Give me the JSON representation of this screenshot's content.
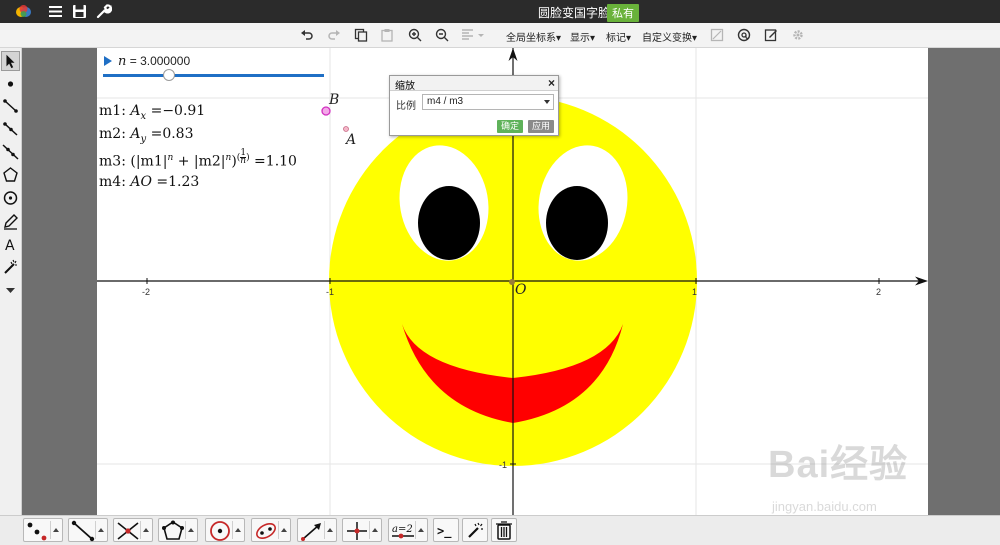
{
  "title_bar": {
    "document_title": "圆脸变国字脸",
    "badge": "私有",
    "icons": [
      "app-logo-icon",
      "menu-icon",
      "save-icon",
      "wrench-icon"
    ]
  },
  "toolbar": {
    "menus": [
      {
        "label": "全局坐标系▾"
      },
      {
        "label": "显示▾"
      },
      {
        "label": "标记▾"
      },
      {
        "label": "自定义变换▾"
      }
    ],
    "icons": [
      "undo-icon",
      "redo-icon",
      "copy-icon",
      "paste-icon",
      "zoom-in-icon",
      "zoom-out-icon",
      "align-icon",
      "snapshot-icon",
      "link-icon",
      "edit-icon",
      "settings-icon"
    ]
  },
  "left_tools": [
    "pointer-tool",
    "point-tool",
    "segment-tool",
    "ray-tool",
    "line-tool",
    "polygon-tool",
    "circle-tool",
    "pencil-tool",
    "text-tool",
    "magic-tool",
    "more-tools"
  ],
  "slider": {
    "variable": "n",
    "equals": " = ",
    "value": "3.000000",
    "position": 0.3
  },
  "measurements": [
    {
      "name": "m1",
      "expr": "A",
      "sub": "x",
      "value": "−0.91"
    },
    {
      "name": "m2",
      "expr": "A",
      "sub": "y",
      "value": "0.83"
    },
    {
      "name": "m3",
      "formula_a": "m1",
      "formula_b": "m2",
      "exp": "n",
      "frac_num": "1",
      "frac_den": "n",
      "value": "1.10"
    },
    {
      "name": "m4",
      "expr": "AO",
      "value": "1.23"
    }
  ],
  "points": {
    "A": "A",
    "B": "B",
    "O": "O"
  },
  "axis": {
    "x_ticks": [
      "-2",
      "-1",
      "1",
      "2"
    ],
    "y_ticks": [
      "-1"
    ]
  },
  "dialog": {
    "title": "缩放",
    "close": "×",
    "ratio_label": "比例",
    "ratio_value": "m4 / m3",
    "ok": "确定",
    "apply": "应用"
  },
  "colors": {
    "face": "#FFFF00",
    "eyes": "#000000",
    "mouth": "#FF0000",
    "slider": "#1F6FC5",
    "badge": "#69B23A"
  },
  "bottom_tools": [
    "point-group",
    "segment-group",
    "intersection-group",
    "polygon-group",
    "circle-group",
    "conic-group",
    "vector-group",
    "transform-group",
    "parameter-group",
    "script-tool",
    "magic-wand-tool",
    "delete-tool"
  ],
  "bottom_labels": {
    "parameter": "a=2",
    "script": ">_"
  },
  "watermark": {
    "brand": "Bai经验",
    "url": "jingyan.baidu.com"
  }
}
